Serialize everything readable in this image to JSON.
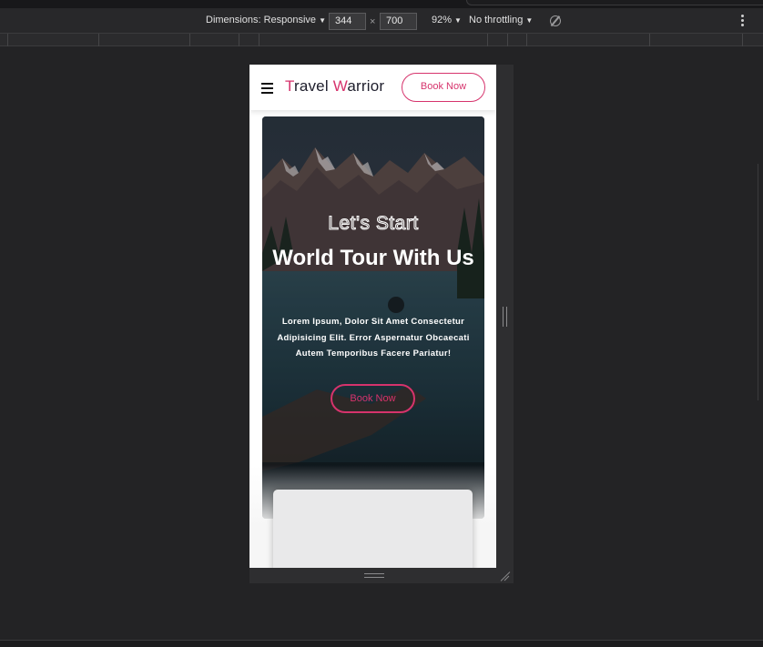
{
  "devtools": {
    "dimensions_label": "Dimensions: Responsive",
    "width_value": "344",
    "times_sign": "×",
    "height_value": "700",
    "zoom_label": "92%",
    "throttle_label": "No throttling",
    "caret": "▼"
  },
  "site": {
    "logo": {
      "first_initial": "T",
      "first_rest": "ravel ",
      "second_initial": "W",
      "second_rest": "arrior"
    },
    "header_button": "Book Now",
    "hero": {
      "kicker": "Let's Start",
      "title": "World Tour With Us",
      "description": "Lorem Ipsum, Dolor Sit Amet Consectetur Adipisicing Elit. Error Aspernatur Obcaecati Autem Temporibus Facere Pariatur!",
      "button": "Book Now"
    }
  },
  "colors": {
    "accent": "#d6336c",
    "devtools_bg": "#232325",
    "toolbar_bg": "#28282a"
  },
  "icons": [
    "hamburger-icon",
    "rotate-icon",
    "more-vertical-icon"
  ]
}
